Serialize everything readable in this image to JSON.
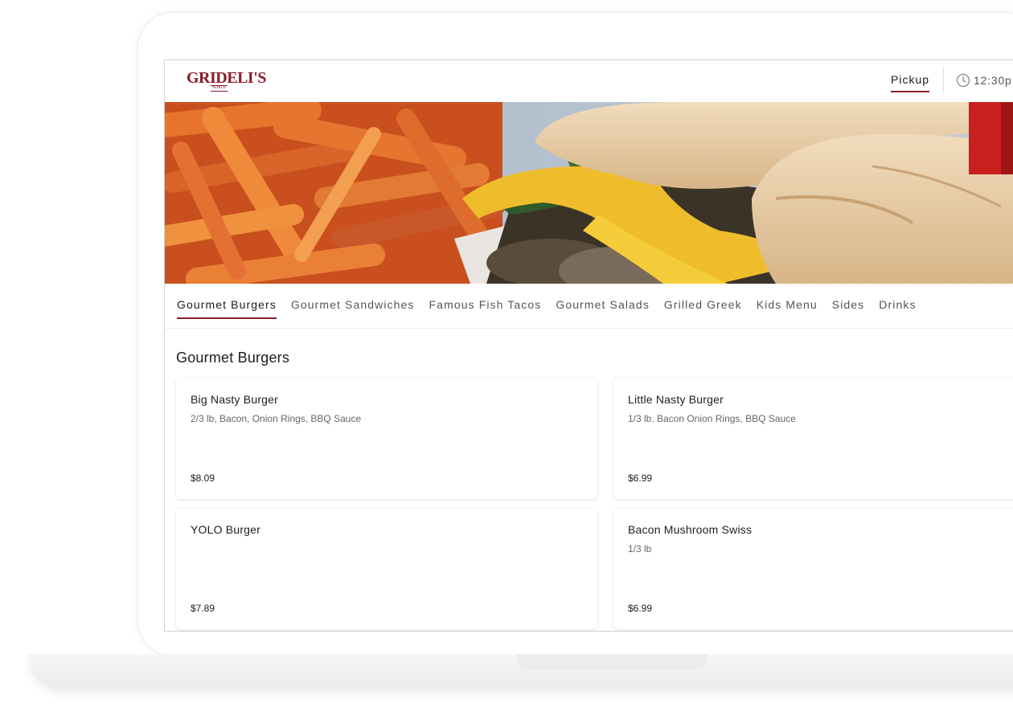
{
  "header": {
    "logo": "GRIDELI'S",
    "logo_sub": "NORTH",
    "order_type": "Pickup",
    "time": "12:30p"
  },
  "categories": [
    "Gourmet Burgers",
    "Gourmet Sandwiches",
    "Famous Fish Tacos",
    "Gourmet Salads",
    "Grilled Greek",
    "Kids Menu",
    "Sides",
    "Drinks"
  ],
  "section": {
    "title": "Gourmet Burgers",
    "items": [
      {
        "name": "Big Nasty Burger",
        "description": "2/3 lb, Bacon, Onion Rings, BBQ Sauce",
        "price": "$8.09"
      },
      {
        "name": "Little Nasty Burger",
        "description": "1/3 lb. Bacon Onion Rings, BBQ Sauce",
        "price": "$6.99"
      },
      {
        "name": "YOLO Burger",
        "description": "",
        "price": "$7.89"
      },
      {
        "name": "Bacon Mushroom Swiss",
        "description": "1/3 lb",
        "price": "$6.99"
      }
    ]
  },
  "colors": {
    "brand": "#8a1c2b"
  }
}
